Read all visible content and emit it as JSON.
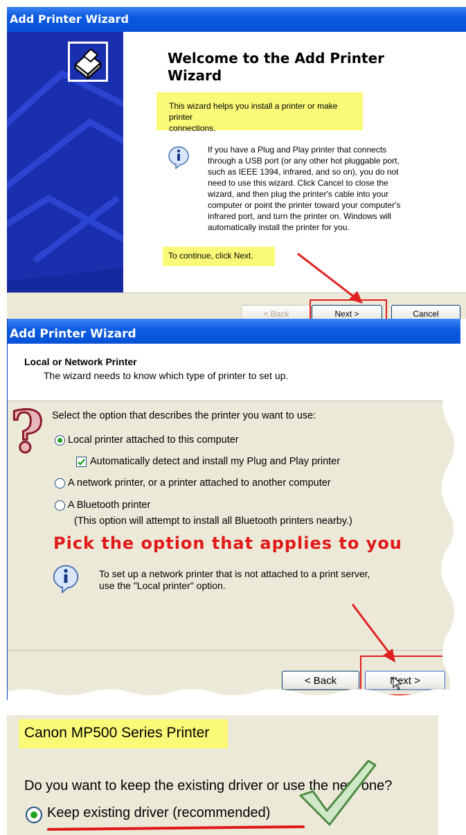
{
  "wizard1": {
    "title": "Add Printer Wizard",
    "heading_line1": "Welcome to the Add Printer",
    "heading_line2": "Wizard",
    "intro_line1": "This wizard helps you install a printer or make printer",
    "intro_line2": "connections.",
    "body_lines": [
      "If you have a Plug and Play printer that connects",
      "through a USB port (or any other hot pluggable port,",
      "such as IEEE 1394, infrared, and so on), you do not",
      "need to use this wizard. Click Cancel to close the",
      "wizard, and then plug the printer's cable into your",
      "computer or point the printer toward your computer's",
      "infrared port, and turn the printer on. Windows will",
      "automatically install the printer for you."
    ],
    "continue_text": "To continue, click Next.",
    "back_label": "< Back",
    "next_label": "Next >",
    "cancel_label": "Cancel"
  },
  "wizard2": {
    "title": "Add Printer Wizard",
    "header_title": "Local or Network Printer",
    "header_subtitle": "The wizard needs to know which type of printer to set up.",
    "prompt": "Select the option that describes the printer you want to use:",
    "option_local": "Local printer attached to this computer",
    "option_auto_detect": "Automatically detect and install my Plug and Play printer",
    "option_network": "A network printer, or a printer attached to another computer",
    "option_bluetooth": "A Bluetooth printer",
    "bluetooth_note": "(This option will attempt to install all Bluetooth printers nearby.)",
    "annotation": "Pick the option that applies to you",
    "info_line1": "To set up a network printer that is not attached to a print server,",
    "info_line2": "use the \"Local printer\" option.",
    "back_label": "< Back",
    "next_label": "Next >"
  },
  "dialog3": {
    "printer_name": "Canon MP500 Series Printer",
    "question": "Do you want to keep the existing driver or use the new one?",
    "keep_option": "Keep existing driver (recommended)"
  },
  "colors": {
    "xp_title_blue": "#0a5ae0",
    "highlight_yellow": "#fafa78",
    "annotation_red": "#e01818",
    "dialog_beige": "#ece9d8"
  }
}
